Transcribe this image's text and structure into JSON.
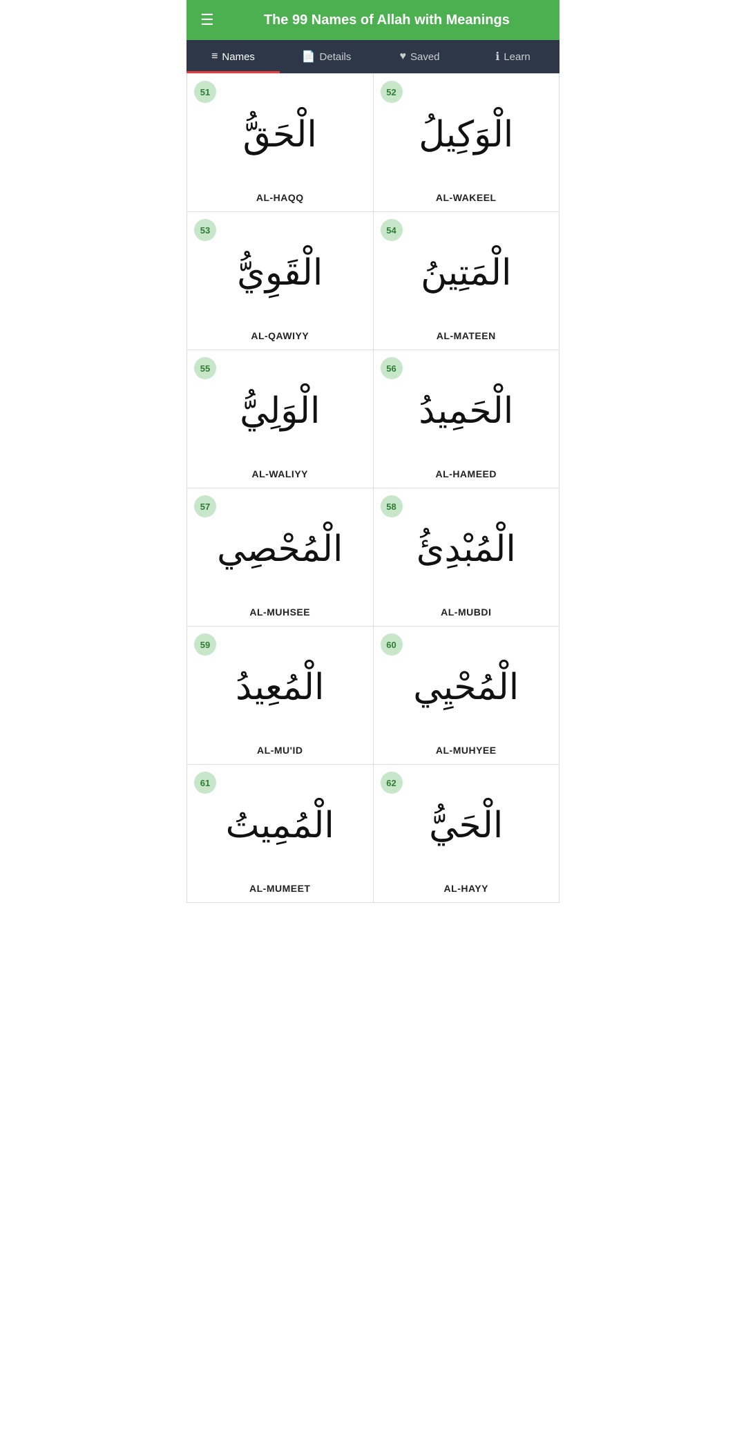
{
  "header": {
    "title": "The 99 Names of Allah with Meanings",
    "menu_icon": "☰"
  },
  "nav": {
    "tabs": [
      {
        "id": "names",
        "label": "Names",
        "icon": "≡",
        "active": true
      },
      {
        "id": "details",
        "label": "Details",
        "icon": "📄",
        "active": false
      },
      {
        "id": "saved",
        "label": "Saved",
        "icon": "♥",
        "active": false
      },
      {
        "id": "learn",
        "label": "Learn",
        "icon": "ℹ",
        "active": false
      }
    ]
  },
  "names": [
    {
      "number": 51,
      "arabic": "الْحَقُّ",
      "transliteration": "AL-HAQQ"
    },
    {
      "number": 52,
      "arabic": "الْوَكِيلُ",
      "transliteration": "AL-WAKEEL"
    },
    {
      "number": 53,
      "arabic": "الْقَوِيُّ",
      "transliteration": "AL-QAWIYY"
    },
    {
      "number": 54,
      "arabic": "الْمَتِينُ",
      "transliteration": "AL-MATEEN"
    },
    {
      "number": 55,
      "arabic": "الْوَلِيُّ",
      "transliteration": "AL-WALIYY"
    },
    {
      "number": 56,
      "arabic": "الْحَمِيدُ",
      "transliteration": "AL-HAMEED"
    },
    {
      "number": 57,
      "arabic": "الْمُحْصِي",
      "transliteration": "AL-MUHSEE"
    },
    {
      "number": 58,
      "arabic": "الْمُبْدِئُ",
      "transliteration": "AL-MUBDI"
    },
    {
      "number": 59,
      "arabic": "الْمُعِيدُ",
      "transliteration": "AL-MU'ID"
    },
    {
      "number": 60,
      "arabic": "الْمُحْيِي",
      "transliteration": "AL-MUHYEE"
    },
    {
      "number": 61,
      "arabic": "الْمُمِيتُ",
      "transliteration": "AL-MUMEET"
    },
    {
      "number": 62,
      "arabic": "الْحَيُّ",
      "transliteration": "AL-HAYY"
    }
  ]
}
